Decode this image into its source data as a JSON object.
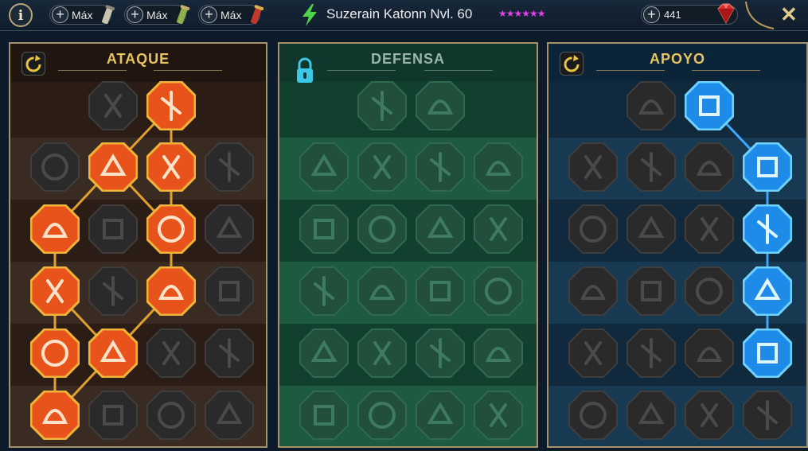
{
  "header": {
    "info_label": "i",
    "pills": [
      {
        "label": "Máx",
        "icon": "silver-scroll-icon"
      },
      {
        "label": "Máx",
        "icon": "green-scroll-icon"
      },
      {
        "label": "Máx",
        "icon": "red-scroll-icon"
      }
    ],
    "title": "Suzerain Katonn Nvl. 60",
    "stars": "★★★★★★",
    "gems": "441",
    "close_label": "✕"
  },
  "colors": {
    "attack_active": "#e8531c",
    "attack_border": "#f0b43a",
    "support_active": "#1e8be8",
    "support_border": "#6fd2ff",
    "link_attack": "#e0a030",
    "link_support": "#3aa8ff",
    "star": "#e040e8"
  },
  "panels": [
    {
      "key": "atk",
      "title": "ATAQUE",
      "control": "reset-icon",
      "rows": [
        [
          "crossed-swords-icon",
          "slash-strike-icon"
        ],
        [
          "horned-helm-icon",
          "triple-arrows-icon",
          "shield-break-icon",
          "bleeding-heart-icon"
        ],
        [
          "flex-arm-icon",
          "fanged-mouth-icon",
          "skull-slash-icon",
          "grab-hand-icon"
        ],
        [
          "sword-heart-icon",
          "fist-icon",
          "axe-strike-icon",
          "chain-bolt-icon"
        ],
        [
          "burst-arrows-icon",
          "triple-skull-icon",
          "glaive-icon",
          "warrior-icon"
        ],
        [
          "sword-slash-icon",
          "knight-helm-icon",
          "demon-icon",
          "spiked-skull-icon"
        ]
      ],
      "active": [
        [
          false,
          true
        ],
        [
          false,
          true,
          true,
          false
        ],
        [
          true,
          false,
          true,
          false
        ],
        [
          true,
          false,
          true,
          false
        ],
        [
          true,
          true,
          false,
          false
        ],
        [
          true,
          false,
          false,
          false
        ]
      ]
    },
    {
      "key": "def",
      "title": "DEFENSA",
      "control": "lock-icon",
      "rows": [
        [
          "shield-grid-icon",
          "raised-fist-icon"
        ],
        [
          "chevron-shield-icon",
          "anatomical-heart-icon",
          "iron-golem-icon",
          "blade-icon"
        ],
        [
          "runner-icon",
          "tower-shield-icon",
          "skull-shield-icon",
          "hooded-face-icon"
        ],
        [
          "standing-figure-icon",
          "hourglass-icon",
          "open-palm-icon",
          "bull-head-icon"
        ],
        [
          "leaping-figure-icon",
          "spikes-icon",
          "skull-aura-icon",
          "dragon-icon"
        ],
        [
          "ghoul-icon",
          "crest-shield-icon",
          "stone-face-icon",
          "muscle-figure-icon"
        ]
      ],
      "active": [
        [
          false,
          false
        ],
        [
          false,
          false,
          false,
          false
        ],
        [
          false,
          false,
          false,
          false
        ],
        [
          false,
          false,
          false,
          false
        ],
        [
          false,
          false,
          false,
          false
        ],
        [
          false,
          false,
          false,
          false
        ]
      ]
    },
    {
      "key": "sup",
      "title": "APOYO",
      "control": "reset-icon",
      "rows": [
        [
          "heart-plus-icon",
          "fire-orb-icon"
        ],
        [
          "praying-hands-icon",
          "aura-shield-icon",
          "skull-icon",
          "swift-blade-icon"
        ],
        [
          "healer-icon",
          "lightning-icon",
          "storm-icon",
          "team-figures-icon"
        ],
        [
          "chained-heart-icon",
          "meteor-icon",
          "spell-book-icon",
          "angry-eyes-icon"
        ],
        [
          "compass-star-icon",
          "winged-boot-icon",
          "all-seeing-eye-icon",
          "acrobat-icon"
        ],
        [
          "potion-icon",
          "skull-crown-icon",
          "stone-fist-icon",
          "eagle-icon"
        ]
      ],
      "active": [
        [
          false,
          true
        ],
        [
          false,
          false,
          false,
          true
        ],
        [
          false,
          false,
          false,
          true
        ],
        [
          false,
          false,
          false,
          true
        ],
        [
          false,
          false,
          false,
          true
        ],
        [
          false,
          false,
          false,
          false
        ]
      ]
    }
  ]
}
